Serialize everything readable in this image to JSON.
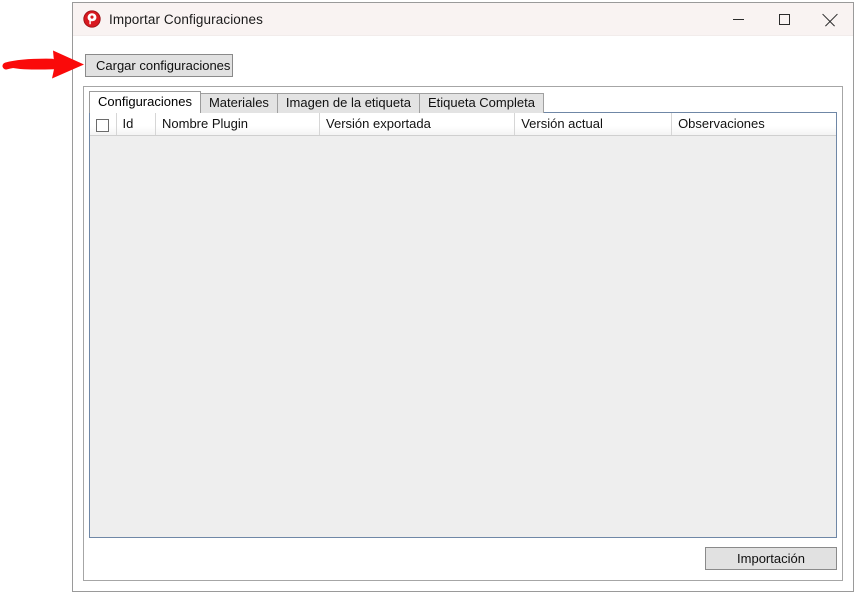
{
  "window": {
    "title": "Importar Configuraciones",
    "icon": "app-red-circle-icon",
    "caption": {
      "minimize_label": "Minimizar",
      "maximize_label": "Maximizar",
      "close_label": "Cerrar"
    }
  },
  "toolbar": {
    "load_button_label": "Cargar configuraciones"
  },
  "tabs": [
    {
      "label": "Configuraciones",
      "active": true
    },
    {
      "label": "Materiales",
      "active": false
    },
    {
      "label": "Imagen de la etiqueta",
      "active": false
    },
    {
      "label": "Etiqueta Completa",
      "active": false
    }
  ],
  "table": {
    "select_all_checked": false,
    "columns": [
      {
        "key": "select",
        "label": ""
      },
      {
        "key": "id",
        "label": "Id"
      },
      {
        "key": "plugin",
        "label": "Nombre Plugin"
      },
      {
        "key": "exported_version",
        "label": "Versión exportada"
      },
      {
        "key": "current_version",
        "label": "Versión actual"
      },
      {
        "key": "observations",
        "label": "Observaciones"
      }
    ],
    "rows": []
  },
  "footer": {
    "import_button_label": "Importación"
  },
  "annotation": {
    "arrow_color": "#fa0a0a",
    "points_to": "Cargar configuraciones"
  },
  "colors": {
    "titlebar_bg": "#f9f3f2",
    "window_bg": "#ffffff",
    "button_face": "#e1e1e1",
    "grid_body_bg": "#eeeeee",
    "grid_border": "#6f87a6",
    "accent_red": "#d81920"
  }
}
